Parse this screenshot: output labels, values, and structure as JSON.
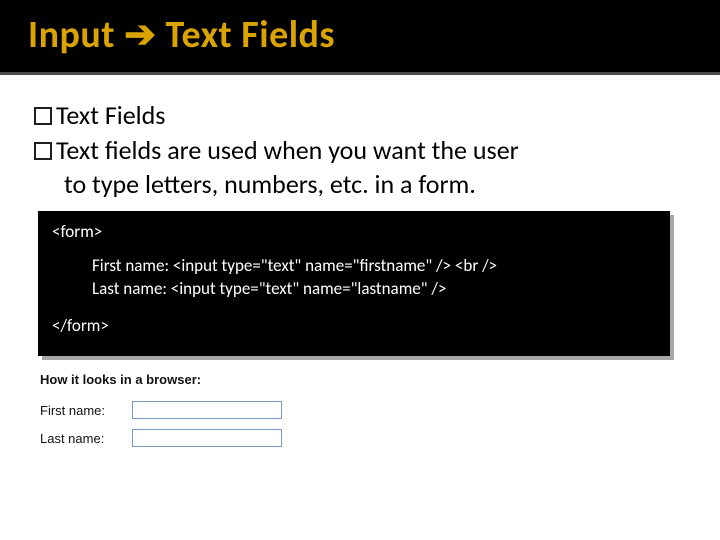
{
  "title": "Input ➔ Text Fields",
  "bullets": {
    "heading": "Text Fields",
    "desc_line1": "Text fields are used when you want the user",
    "desc_line2": "to type letters, numbers, etc. in a form."
  },
  "code": {
    "open": "<form>",
    "line1": "First name: <input type=\"text\" name=\"firstname\" /> <br />",
    "line2": "Last name: <input type=\"text\" name=\"lastname\" />",
    "close": "</form>"
  },
  "preview": {
    "heading": "How it looks in a browser:",
    "label_first": "First name:",
    "label_last": "Last name:"
  }
}
